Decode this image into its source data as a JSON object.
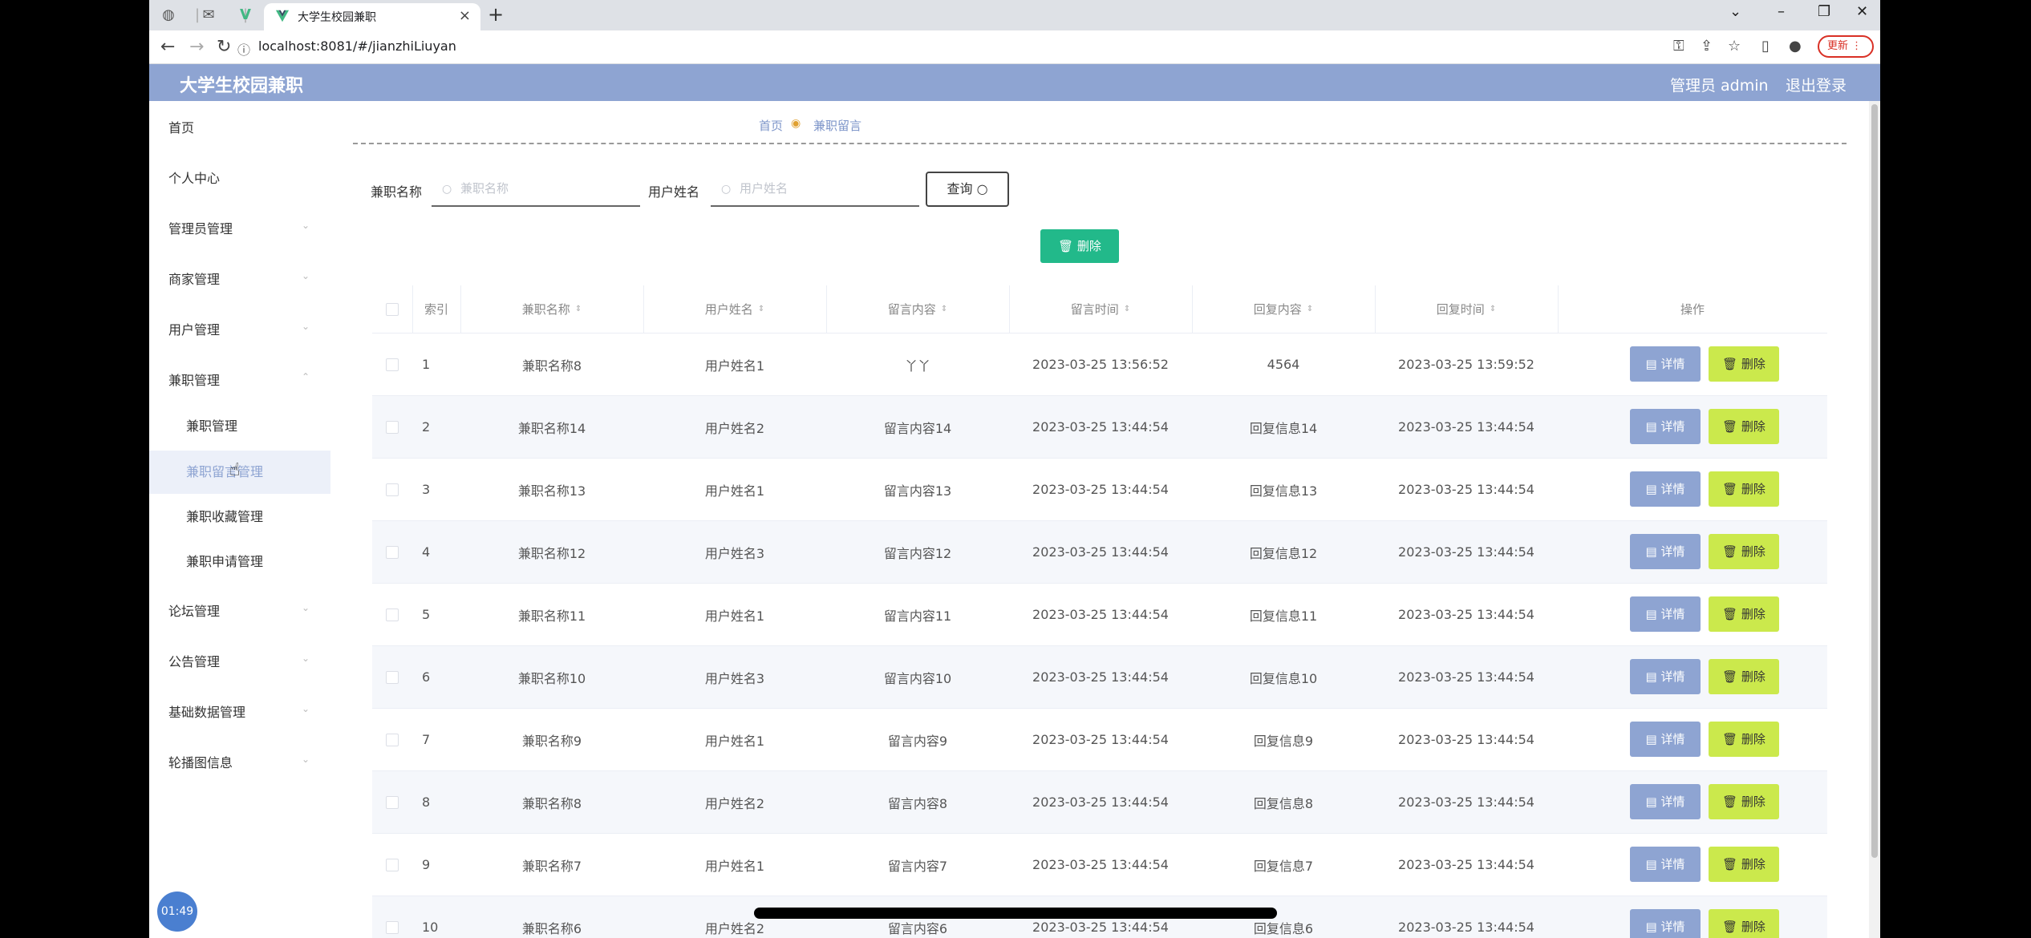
{
  "browser": {
    "tab_title": "大学生校园兼职",
    "url": "localhost:8081/#/jianzhiLiuyan",
    "update_label": "更新"
  },
  "header": {
    "brand": "大学生校园兼职",
    "user": "管理员 admin",
    "logout": "退出登录"
  },
  "sidebar": {
    "items": [
      {
        "label": "首页"
      },
      {
        "label": "个人中心"
      },
      {
        "label": "管理员管理"
      },
      {
        "label": "商家管理"
      },
      {
        "label": "用户管理"
      },
      {
        "label": "兼职管理"
      }
    ],
    "sub_items": [
      {
        "label": "兼职管理"
      },
      {
        "label": "兼职留言管理"
      },
      {
        "label": "兼职收藏管理"
      },
      {
        "label": "兼职申请管理"
      }
    ],
    "items_after": [
      {
        "label": "论坛管理"
      },
      {
        "label": "公告管理"
      },
      {
        "label": "基础数据管理"
      },
      {
        "label": "轮播图信息"
      }
    ]
  },
  "breadcrumb": {
    "home": "首页",
    "current": "兼职留言"
  },
  "search": {
    "field1_label": "兼职名称",
    "field1_placeholder": "兼职名称",
    "field2_label": "用户姓名",
    "field2_placeholder": "用户姓名",
    "query_button": "查询"
  },
  "toolbar": {
    "delete_label": "删除"
  },
  "table": {
    "columns": [
      "索引",
      "兼职名称",
      "用户姓名",
      "留言内容",
      "留言时间",
      "回复内容",
      "回复时间",
      "操作"
    ],
    "detail_label": "详情",
    "delete_label": "删除",
    "rows": [
      [
        "1",
        "兼职名称8",
        "用户姓名1",
        "丫丫",
        "2023-03-25 13:56:52",
        "4564",
        "2023-03-25 13:59:52"
      ],
      [
        "2",
        "兼职名称14",
        "用户姓名2",
        "留言内容14",
        "2023-03-25 13:44:54",
        "回复信息14",
        "2023-03-25 13:44:54"
      ],
      [
        "3",
        "兼职名称13",
        "用户姓名1",
        "留言内容13",
        "2023-03-25 13:44:54",
        "回复信息13",
        "2023-03-25 13:44:54"
      ],
      [
        "4",
        "兼职名称12",
        "用户姓名3",
        "留言内容12",
        "2023-03-25 13:44:54",
        "回复信息12",
        "2023-03-25 13:44:54"
      ],
      [
        "5",
        "兼职名称11",
        "用户姓名1",
        "留言内容11",
        "2023-03-25 13:44:54",
        "回复信息11",
        "2023-03-25 13:44:54"
      ],
      [
        "6",
        "兼职名称10",
        "用户姓名3",
        "留言内容10",
        "2023-03-25 13:44:54",
        "回复信息10",
        "2023-03-25 13:44:54"
      ],
      [
        "7",
        "兼职名称9",
        "用户姓名1",
        "留言内容9",
        "2023-03-25 13:44:54",
        "回复信息9",
        "2023-03-25 13:44:54"
      ],
      [
        "8",
        "兼职名称8",
        "用户姓名2",
        "留言内容8",
        "2023-03-25 13:44:54",
        "回复信息8",
        "2023-03-25 13:44:54"
      ],
      [
        "9",
        "兼职名称7",
        "用户姓名1",
        "留言内容7",
        "2023-03-25 13:44:54",
        "回复信息7",
        "2023-03-25 13:44:54"
      ],
      [
        "10",
        "兼职名称6",
        "用户姓名2",
        "留言内容6",
        "2023-03-25 13:44:54",
        "回复信息6",
        "2023-03-25 13:44:54"
      ]
    ]
  },
  "overlay": {
    "timer": "01:49"
  },
  "colors": {
    "header_bg": "#8ea4d2",
    "delete_green": "#22b98a",
    "detail_blue": "#8ea4d2",
    "row_delete_lime": "#cbe94c"
  }
}
